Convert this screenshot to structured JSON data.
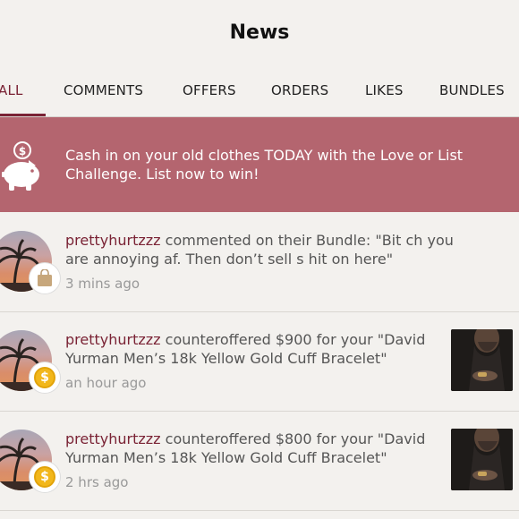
{
  "header": {
    "title": "News"
  },
  "tabs": [
    {
      "label": "ALL",
      "active": true
    },
    {
      "label": "COMMENTS",
      "active": false
    },
    {
      "label": "OFFERS",
      "active": false
    },
    {
      "label": "ORDERS",
      "active": false
    },
    {
      "label": "LIKES",
      "active": false
    },
    {
      "label": "BUNDLES",
      "active": false
    }
  ],
  "banner": {
    "icon": "piggy-bank-icon",
    "text": "Cash in on your old clothes TODAY with the Love or List Challenge. List now to win!"
  },
  "feed": [
    {
      "username": "prettyhurtzzz",
      "action": " commented on their Bundle: \"Bit ch you are annoying af. Then don’t sell s hit on here\"",
      "time": "3 mins ago",
      "badge_icon": "shopping-bag-icon"
    },
    {
      "username": "prettyhurtzzz",
      "action": " counteroffered $900 for your \"David Yurman Men’s 18k Yellow Gold Cuff Bracelet\"",
      "time": "an hour ago",
      "badge_icon": "dollar-coin-icon"
    },
    {
      "username": "prettyhurtzzz",
      "action": " counteroffered $800 for your \"David Yurman Men’s 18k Yellow Gold Cuff Bracelet\"",
      "time": "2 hrs ago",
      "badge_icon": "dollar-coin-icon"
    }
  ],
  "colors": {
    "accent": "#7a2335",
    "banner": "#b4656f",
    "coin": "#f2b71b"
  }
}
